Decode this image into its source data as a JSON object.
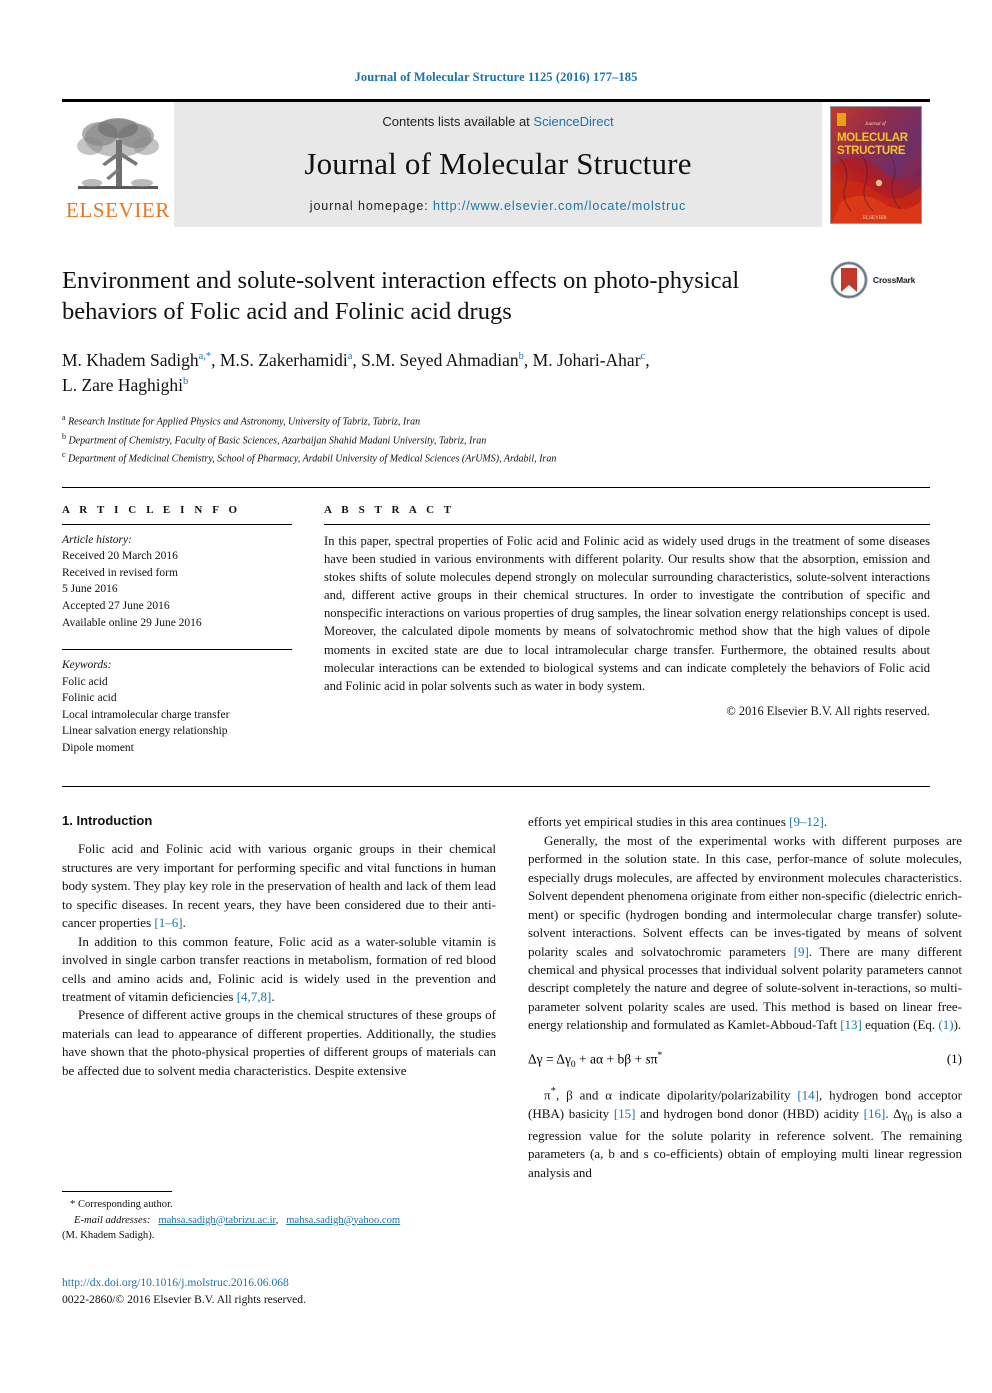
{
  "running_head": "Journal of Molecular Structure 1125 (2016) 177–185",
  "masthead": {
    "contents_prefix": "Contents lists available at ",
    "contents_link": "ScienceDirect",
    "journal_title": "Journal of Molecular Structure",
    "homepage_label": "journal homepage: ",
    "homepage_url": "http://www.elsevier.com/locate/molstruc",
    "elsevier_wordmark": "ELSEVIER",
    "cover_journal_small": "Journal of",
    "cover_line1": "MOLECULAR",
    "cover_line2": "STRUCTURE",
    "cover_publisher": "ELSEVIER"
  },
  "title": "Environment and solute-solvent interaction effects on photo-physical behaviors of Folic acid and Folinic acid drugs",
  "crossmark_label": "CrossMark",
  "authors_line1_pre": "M. Khadem Sadigh ",
  "authors": "M. Khadem Sadigh a,*, M.S. Zakerhamidi a, S.M. Seyed Ahmadian b, M. Johari-Ahar c, L. Zare Haghighi b",
  "affiliations": [
    {
      "mark": "a",
      "text": "Research Institute for Applied Physics and Astronomy, University of Tabriz, Tabriz, Iran"
    },
    {
      "mark": "b",
      "text": "Department of Chemistry, Faculty of Basic Sciences, Azarbaijan Shahid Madani University, Tabriz, Iran"
    },
    {
      "mark": "c",
      "text": "Department of Medicinal Chemistry, School of Pharmacy, Ardabil University of Medical Sciences (ArUMS), Ardabil, Iran"
    }
  ],
  "article_info": {
    "heading": "A R T I C L E   I N F O",
    "history_label": "Article history:",
    "history": [
      "Received 20 March 2016",
      "Received in revised form",
      "5 June 2016",
      "Accepted 27 June 2016",
      "Available online 29 June 2016"
    ],
    "keywords_label": "Keywords:",
    "keywords": [
      "Folic acid",
      "Folinic acid",
      "Local intramolecular charge transfer",
      "Linear salvation energy relationship",
      "Dipole moment"
    ]
  },
  "abstract": {
    "heading": "A B S T R A C T",
    "text": "In this paper, spectral properties of Folic acid and Folinic acid as widely used drugs in the treatment of some diseases have been studied in various environments with different polarity. Our results show that the absorption, emission and stokes shifts of solute molecules depend strongly on molecular surrounding characteristics, solute-solvent interactions and, different active groups in their chemical structures. In order to investigate the contribution of specific and nonspecific interactions on various properties of drug samples, the linear solvation energy relationships concept is used. Moreover, the calculated dipole moments by means of solvatochromic method show that the high values of dipole moments in excited state are due to local intramolecular charge transfer. Furthermore, the obtained results about molecular interactions can be extended to biological systems and can indicate completely the behaviors of Folic acid and Folinic acid in polar solvents such as water in body system.",
    "copyright": "© 2016 Elsevier B.V. All rights reserved."
  },
  "body": {
    "section_title": "1. Introduction",
    "left_paragraphs": [
      "Folic acid and Folinic acid with various organic groups in their chemical structures are very important for performing specific and vital functions in human body system. They play key role in the preservation of health and lack of them lead to specific diseases. In recent years, they have been considered due to their anti-cancer properties [1–6].",
      "In addition to this common feature, Folic acid as a water-soluble vitamin is involved in single carbon transfer reactions in metabolism, formation of red blood cells and amino acids and, Folinic acid is widely used in the prevention and treatment of vitamin deficiencies [4,7,8].",
      "Presence of different active groups in the chemical structures of these groups of materials can lead to appearance of different properties. Additionally, the studies have shown that the photo-physical properties of different groups of materials can be affected due to solvent media characteristics. Despite extensive"
    ],
    "right_paragraphs": [
      "efforts yet empirical studies in this area continues [9–12].",
      "Generally, the most of the experimental works with different purposes are performed in the solution state. In this case, performance of solute molecules, especially drugs molecules, are affected by environment molecules characteristics. Solvent dependent phenomena originate from either non-specific (dielectric enrichment) or specific (hydrogen bonding and intermolecular charge transfer) solute-solvent interactions. Solvent effects can be investigated by means of solvent polarity scales and solvatochromic parameters [9]. There are many different chemical and physical processes that individual solvent polarity parameters cannot descript completely the nature and degree of solute-solvent interactions, so multi-parameter solvent polarity scales are used. This method is based on linear free-energy relationship and formulated as Kamlet-Abboud-Taft [13] equation (Eq. (1))."
    ],
    "equation_text": "Δν = Δν0 + aα + bβ + sπ*",
    "equation_number": "(1)",
    "right_paragraph_after_eq": "π*, β and α indicate dipolarity/polarizability [14], hydrogen bond acceptor (HBA) basicity [15] and hydrogen bond donor (HBD) acidity [16]. Δν0 is also a regression value for the solute polarity in reference solvent. The remaining parameters (a, b and s coefficients) obtain of employing multi linear regression analysis and"
  },
  "footnote": {
    "corresponding": "* Corresponding author.",
    "email_label": "E-mail addresses:",
    "email1": "mahsa.sadigh@tabrizu.ac.ir",
    "email2": "mahsa.sadigh@yahoo.com",
    "email_owner": "(M. Khadem Sadigh)."
  },
  "page_footer": {
    "doi": "http://dx.doi.org/10.1016/j.molstruc.2016.06.068",
    "issn": "0022-2860/© 2016 Elsevier B.V. All rights reserved."
  },
  "colors": {
    "link": "#1a74a8",
    "elsevier_orange": "#e87722",
    "masthead_grey": "#e8e8e8"
  }
}
